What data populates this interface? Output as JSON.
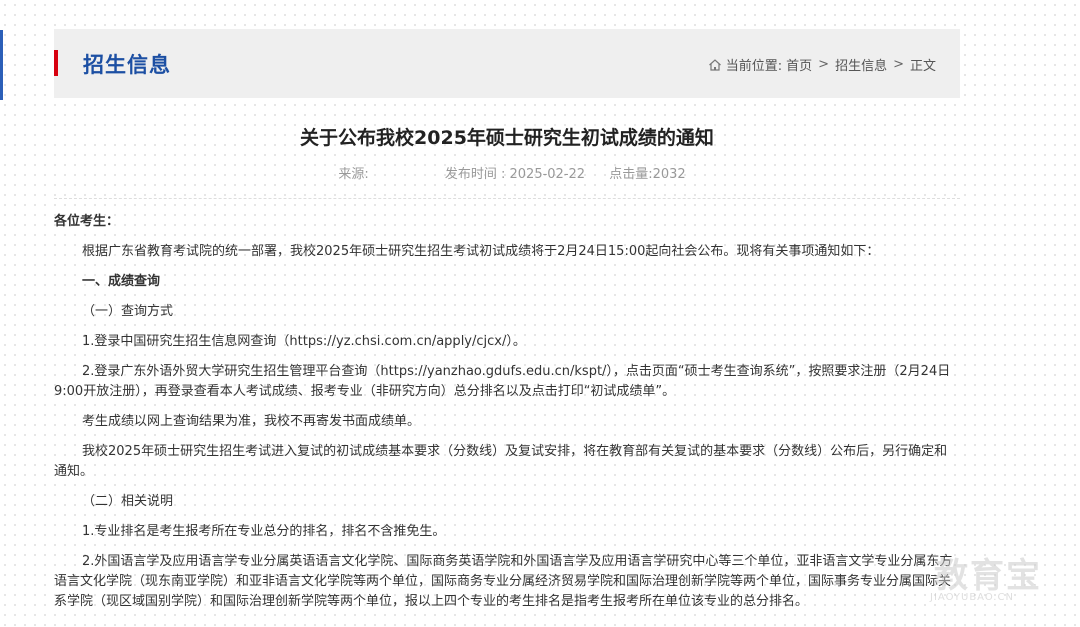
{
  "header": {
    "section_title": "招生信息",
    "breadcrumb": {
      "prefix": "当前位置:",
      "items": [
        "首页",
        "招生信息",
        "正文"
      ],
      "separator": ">"
    }
  },
  "article": {
    "title": "关于公布我校2025年硕士研究生初试成绩的通知",
    "meta": {
      "source_label": "来源:",
      "publish_time": "发布时间 : 2025-02-22",
      "views": "点击量:2032"
    },
    "greeting": "各位考生：",
    "paragraphs": [
      "根据广东省教育考试院的统一部署，我校2025年硕士研究生招生考试初试成绩将于2月24日15:00起向社会公布。现将有关事项通知如下：",
      "一、成绩查询",
      "（一）查询方式",
      "1.登录中国研究生招生信息网查询（https://yz.chsi.com.cn/apply/cjcx/）。",
      "2.登录广东外语外贸大学研究生招生管理平台查询（https://yanzhao.gdufs.edu.cn/kspt/），点击页面“硕士考生查询系统”，按照要求注册（2月24日9:00开放注册），再登录查看本人考试成绩、报考专业（非研究方向）总分排名以及点击打印“初试成绩单”。",
      "考生成绩以网上查询结果为准，我校不再寄发书面成绩单。",
      "我校2025年硕士研究生招生考试进入复试的初试成绩基本要求（分数线）及复试安排，将在教育部有关复试的基本要求（分数线）公布后，另行确定和通知。",
      "（二）相关说明",
      "1.专业排名是考生报考所在专业总分的排名，排名不含推免生。",
      "2.外国语言学及应用语言学专业分属英语语言文化学院、国际商务英语学院和外国语言学及应用语言学研究中心等三个单位，亚非语言文学专业分属东方语言文化学院（现东南亚学院）和亚非语言文化学院等两个单位，国际商务专业分属经济贸易学院和国际治理创新学院等两个单位，国际事务专业分属国际关系学院（现区域国别学院）和国际治理创新学院等两个单位，报以上四个专业的考生排名是指考生报考所在单位该专业的总分排名。"
    ]
  },
  "watermark": {
    "brand": "教育宝",
    "domain": "JIAOYUBAO.CN"
  },
  "colors": {
    "accent_blue": "#1c4fa3",
    "accent_red": "#d7000f"
  }
}
